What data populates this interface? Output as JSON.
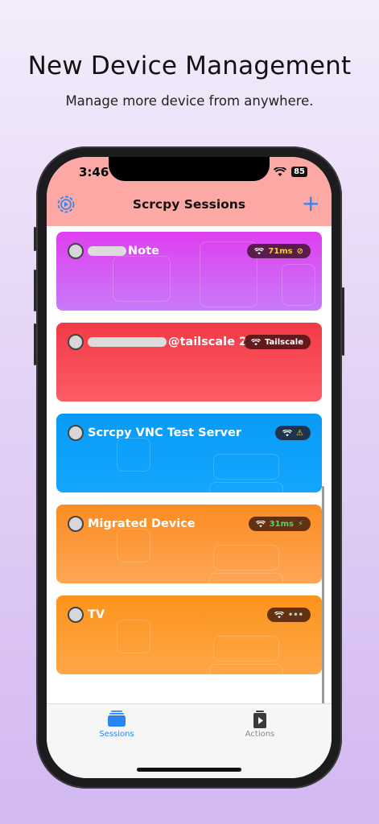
{
  "promo": {
    "headline": "New Device Management",
    "subline": "Manage more device from anywhere."
  },
  "status_bar": {
    "time": "3:46",
    "battery": "85"
  },
  "nav": {
    "title": "Scrcpy Sessions",
    "add_icon": "plus-icon",
    "settings_icon": "gear-icon"
  },
  "sessions": [
    {
      "name_suffix": "Note",
      "redacted": true,
      "color_top": "#df3ef0",
      "color_bottom": "#c97af9",
      "pill_text": "71ms",
      "pill_text_color": "#f7c948",
      "pill_extra": "⊘"
    },
    {
      "name_suffix": "@tailscale 2",
      "redacted": true,
      "color_top": "#f33a47",
      "color_bottom": "#fb5d66",
      "pill_text": "Tailscale",
      "pill_text_color": "#ffffff",
      "pill_extra": ""
    },
    {
      "name_suffix": "Scrcpy VNC Test Server",
      "redacted": false,
      "color_top": "#089bf5",
      "color_bottom": "#15a6ff",
      "pill_text": "",
      "pill_text_color": "#f7e048",
      "pill_extra": "⚠"
    },
    {
      "name_suffix": "Migrated Device",
      "redacted": false,
      "color_top": "#fb8c22",
      "color_bottom": "#fea655",
      "pill_text": "31ms",
      "pill_text_color": "#4cd964",
      "pill_extra": "⚡"
    },
    {
      "name_suffix": "TV",
      "redacted": false,
      "color_top": "#fd931b",
      "color_bottom": "#fea748",
      "pill_text": "",
      "pill_text_color": "#cccccc",
      "pill_extra": "•••"
    }
  ],
  "tabs": [
    {
      "label": "Sessions",
      "icon": "stack-icon",
      "active": true,
      "color": "#2b86f2"
    },
    {
      "label": "Actions",
      "icon": "play-doc-icon",
      "active": false,
      "color": "#8a8a8e"
    }
  ]
}
